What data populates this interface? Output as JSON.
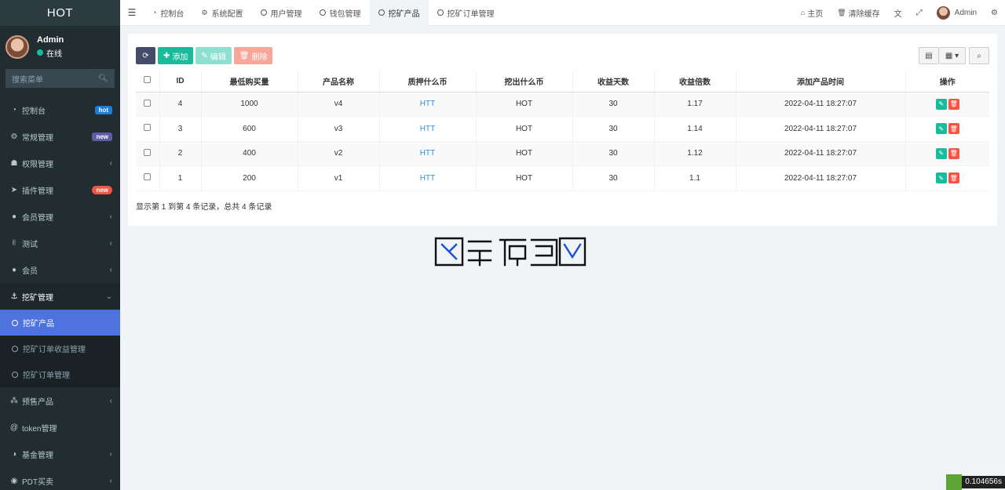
{
  "app": {
    "logo": "HOT"
  },
  "user": {
    "name": "Admin",
    "status": "在线"
  },
  "sidebar": {
    "search_placeholder": "搜索菜单",
    "items": [
      {
        "label": "控制台",
        "icon": "dashboard-icon",
        "badge": "hot"
      },
      {
        "label": "常规管理",
        "icon": "cogs-icon",
        "badge": "new"
      },
      {
        "label": "权限管理",
        "icon": "group-icon"
      },
      {
        "label": "插件管理",
        "icon": "rocket-icon",
        "badge": "new"
      },
      {
        "label": "会员管理",
        "icon": "user-circle-icon"
      },
      {
        "label": "测试",
        "icon": "hand-icon"
      },
      {
        "label": "会员",
        "icon": "user-circle-icon"
      },
      {
        "label": "挖矿管理",
        "icon": "anchor-icon"
      },
      {
        "label": "预售产品",
        "icon": "sitemap-icon"
      },
      {
        "label": "token管理",
        "icon": "at-icon"
      },
      {
        "label": "基金管理",
        "icon": "adjust-icon"
      },
      {
        "label": "PDT买卖",
        "icon": "compass-icon"
      }
    ],
    "submenu": [
      {
        "label": "挖矿产品"
      },
      {
        "label": "挖矿订单收益管理"
      },
      {
        "label": "挖矿订单管理"
      }
    ]
  },
  "topbar": {
    "tabs": [
      {
        "label": "控制台",
        "icon": "dashboard-icon"
      },
      {
        "label": "系统配置",
        "icon": "gear-icon"
      },
      {
        "label": "用户管理",
        "icon": "circle-icon"
      },
      {
        "label": "钱包管理",
        "icon": "circle-icon"
      },
      {
        "label": "挖矿产品",
        "icon": "circle-icon"
      },
      {
        "label": "挖矿订单管理",
        "icon": "circle-icon"
      }
    ],
    "home": "主页",
    "clear_cache": "清除缓存",
    "admin": "Admin"
  },
  "toolbar": {
    "add": "添加",
    "edit": "编辑",
    "delete": "删除"
  },
  "table": {
    "columns": [
      "ID",
      "最低购买量",
      "产品名称",
      "质押什么币",
      "挖出什么币",
      "收益天数",
      "收益倍数",
      "添加产品时间",
      "操作"
    ],
    "rows": [
      {
        "id": "4",
        "min": "1000",
        "name": "v4",
        "stake": "HTT",
        "mine": "HOT",
        "days": "30",
        "mult": "1.17",
        "time": "2022-04-11 18:27:07"
      },
      {
        "id": "3",
        "min": "600",
        "name": "v3",
        "stake": "HTT",
        "mine": "HOT",
        "days": "30",
        "mult": "1.14",
        "time": "2022-04-11 18:27:07"
      },
      {
        "id": "2",
        "min": "400",
        "name": "v2",
        "stake": "HTT",
        "mine": "HOT",
        "days": "30",
        "mult": "1.12",
        "time": "2022-04-11 18:27:07"
      },
      {
        "id": "1",
        "min": "200",
        "name": "v1",
        "stake": "HTT",
        "mine": "HOT",
        "days": "30",
        "mult": "1.1",
        "time": "2022-04-11 18:27:07"
      }
    ],
    "summary": "显示第 1 到第 4 条记录，总共 4 条记录"
  },
  "debug": {
    "time": "0.104656s"
  },
  "colors": {
    "sidebar_bg": "#222d32",
    "active_blue": "#4e73df",
    "green": "#18bc9c",
    "red": "#f75444"
  }
}
